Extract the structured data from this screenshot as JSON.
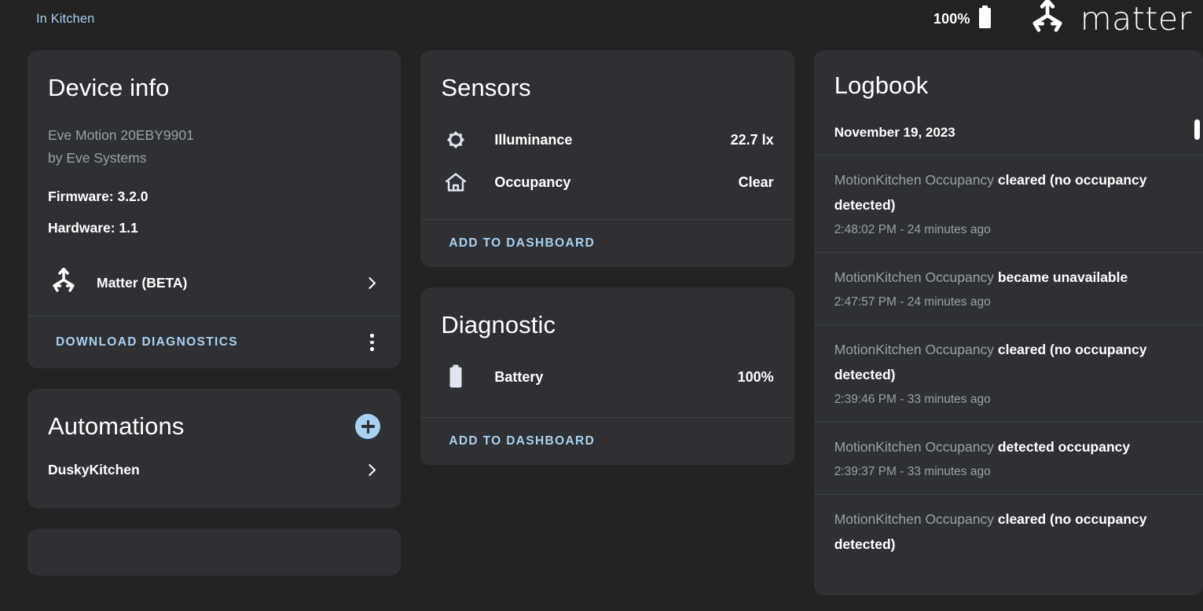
{
  "header": {
    "breadcrumb": "In Kitchen",
    "battery_percent": "100%",
    "battery_icon": "battery-full-icon",
    "brand_name": "matter",
    "brand_icon": "matter-logo-icon"
  },
  "device_info": {
    "title": "Device info",
    "model": "Eve Motion 20EBY9901",
    "manufacturer": "by Eve Systems",
    "firmware": "Firmware: 3.2.0",
    "hardware": "Hardware: 1.1",
    "integration_row": {
      "label": "Matter (BETA)",
      "icon": "matter-logo-icon",
      "chevron": "chevron-right-icon"
    },
    "download_diagnostics": "DOWNLOAD DIAGNOSTICS",
    "overflow_icon": "kebab-menu-icon"
  },
  "automations": {
    "title": "Automations",
    "add_icon": "plus-circle-icon",
    "items": [
      {
        "label": "DuskyKitchen",
        "chevron": "chevron-right-icon"
      }
    ]
  },
  "sensors": {
    "title": "Sensors",
    "rows": [
      {
        "icon": "brightness-icon",
        "name": "Illuminance",
        "value": "22.7 lx"
      },
      {
        "icon": "home-outline-icon",
        "name": "Occupancy",
        "value": "Clear"
      }
    ],
    "action": "ADD TO DASHBOARD"
  },
  "diagnostic": {
    "title": "Diagnostic",
    "rows": [
      {
        "icon": "battery-full-icon",
        "name": "Battery",
        "value": "100%"
      }
    ],
    "action": "ADD TO DASHBOARD"
  },
  "logbook": {
    "title": "Logbook",
    "date_header": "November 19, 2023",
    "entries": [
      {
        "entity": "MotionKitchen Occupancy ",
        "state": "cleared (no occupancy detected)",
        "time": "2:48:02 PM - 24 minutes ago"
      },
      {
        "entity": "MotionKitchen Occupancy ",
        "state": "became unavailable",
        "time": "2:47:57 PM - 24 minutes ago"
      },
      {
        "entity": "MotionKitchen Occupancy ",
        "state": "cleared (no occupancy detected)",
        "time": "2:39:46 PM - 33 minutes ago"
      },
      {
        "entity": "MotionKitchen Occupancy ",
        "state": "detected occupancy",
        "time": "2:39:37 PM - 33 minutes ago"
      },
      {
        "entity": "MotionKitchen Occupancy ",
        "state": "cleared (no occupancy detected)",
        "time": ""
      }
    ]
  },
  "colors": {
    "page_bg": "#222223",
    "card_bg": "#2e3034",
    "accent": "#a9d1f2",
    "text_primary": "#ffffff",
    "text_secondary": "#9b9fa5",
    "divider": "#3c3f44"
  }
}
